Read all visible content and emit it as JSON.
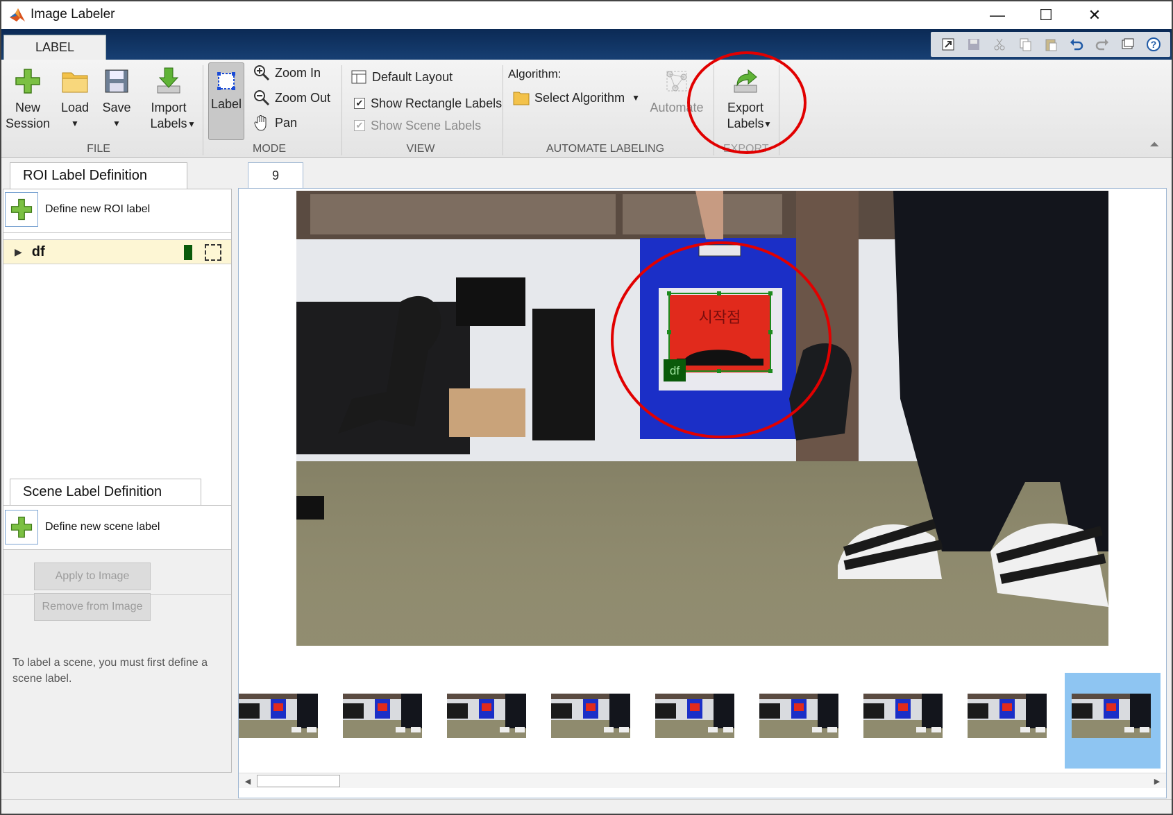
{
  "window": {
    "title": "Image Labeler",
    "min": "—",
    "max": "☐",
    "close": "✕"
  },
  "ribbon": {
    "tab": "LABEL",
    "file": {
      "group": "FILE",
      "new_line1": "New",
      "new_line2": "Session",
      "load": "Load",
      "save": "Save",
      "import_line1": "Import",
      "import_line2": "Labels"
    },
    "mode": {
      "group": "MODE",
      "label": "Label",
      "zoom_in": "Zoom In",
      "zoom_out": "Zoom Out",
      "pan": "Pan"
    },
    "view": {
      "group": "VIEW",
      "default_layout": "Default Layout",
      "show_rect": "Show Rectangle Labels",
      "show_scene": "Show Scene Labels"
    },
    "automate": {
      "group": "AUTOMATE LABELING",
      "algorithm_label": "Algorithm:",
      "select": "Select Algorithm",
      "automate": "Automate"
    },
    "export": {
      "group": "EXPORT",
      "line1": "Export",
      "line2": "Labels"
    }
  },
  "roi_panel": {
    "title": "ROI Label Definition",
    "define": "Define new ROI label",
    "labels": [
      {
        "name": "df",
        "color": "#0a5a0a"
      }
    ]
  },
  "scene_panel": {
    "title": "Scene Label Definition",
    "define": "Define new scene label",
    "apply": "Apply to Image",
    "remove": "Remove from Image",
    "help": "To label a scene, you must first define a scene label."
  },
  "viewer": {
    "tab": "9",
    "box_label": "df",
    "sign_text": "시작점",
    "thumbnail_count": 9,
    "selected_index": 9
  },
  "colors": {
    "accent": "#0b2a55",
    "annotation": "#e10000",
    "label": "#0a5a0a",
    "selected_thumb": "#8ec5f2"
  }
}
